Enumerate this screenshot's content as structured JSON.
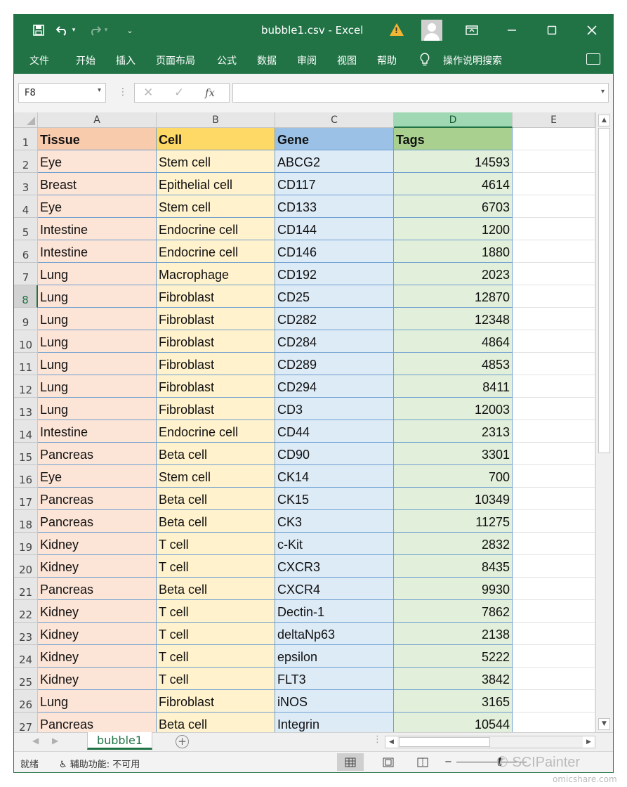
{
  "window": {
    "title": "bubble1.csv  -  Excel",
    "warning_icon": "warning-icon"
  },
  "ribbon": {
    "tabs": [
      "文件",
      "开始",
      "插入",
      "页面布局",
      "公式",
      "数据",
      "审阅",
      "视图",
      "帮助"
    ],
    "tell_me": "操作说明搜索"
  },
  "formula_bar": {
    "name_box": "F8",
    "formula": "",
    "fx_label": "fx"
  },
  "sheet": {
    "columns": [
      "A",
      "B",
      "C",
      "D",
      "E"
    ],
    "selected_column": "D",
    "selected_row": 8,
    "header": [
      "Tissue",
      "Cell",
      "Gene",
      "Tags"
    ],
    "rows": [
      [
        "Eye",
        "Stem cell",
        "ABCG2",
        "14593"
      ],
      [
        "Breast",
        "Epithelial cell",
        "CD117",
        "4614"
      ],
      [
        "Eye",
        "Stem cell",
        "CD133",
        "6703"
      ],
      [
        "Intestine",
        "Endocrine cell",
        "CD144",
        "1200"
      ],
      [
        "Intestine",
        "Endocrine cell",
        "CD146",
        "1880"
      ],
      [
        "Lung",
        "Macrophage",
        "CD192",
        "2023"
      ],
      [
        "Lung",
        "Fibroblast",
        "CD25",
        "12870"
      ],
      [
        "Lung",
        "Fibroblast",
        "CD282",
        "12348"
      ],
      [
        "Lung",
        "Fibroblast",
        "CD284",
        "4864"
      ],
      [
        "Lung",
        "Fibroblast",
        "CD289",
        "4853"
      ],
      [
        "Lung",
        "Fibroblast",
        "CD294",
        "8411"
      ],
      [
        "Lung",
        "Fibroblast",
        "CD3",
        "12003"
      ],
      [
        "Intestine",
        "Endocrine cell",
        "CD44",
        "2313"
      ],
      [
        "Pancreas",
        "Beta cell",
        "CD90",
        "3301"
      ],
      [
        "Eye",
        "Stem cell",
        "CK14",
        "700"
      ],
      [
        "Pancreas",
        "Beta cell",
        "CK15",
        "10349"
      ],
      [
        "Pancreas",
        "Beta cell",
        "CK3",
        "11275"
      ],
      [
        "Kidney",
        "T cell",
        "c-Kit",
        "2832"
      ],
      [
        "Kidney",
        "T cell",
        "CXCR3",
        "8435"
      ],
      [
        "Pancreas",
        "Beta cell",
        "CXCR4",
        "9930"
      ],
      [
        "Kidney",
        "T cell",
        "Dectin-1",
        "7862"
      ],
      [
        "Kidney",
        "T cell",
        "deltaNp63",
        "2138"
      ],
      [
        "Kidney",
        "T cell",
        "epsilon",
        "5222"
      ],
      [
        "Kidney",
        "T cell",
        "FLT3",
        "3842"
      ],
      [
        "Lung",
        "Fibroblast",
        "iNOS",
        "3165"
      ],
      [
        "Pancreas",
        "Beta cell",
        "Integrin",
        "10544"
      ]
    ],
    "tab_name": "bubble1"
  },
  "status_bar": {
    "ready": "就绪",
    "accessibility": "辅助功能: 不可用"
  },
  "watermark": {
    "brand": "SCIPainter",
    "site": "omicshare.com"
  },
  "colors": {
    "excel_green": "#217346",
    "tissue_fill": "#fce4d6",
    "cell_fill": "#fff2cc",
    "gene_fill": "#ddebf7",
    "tags_fill": "#e2efda"
  }
}
